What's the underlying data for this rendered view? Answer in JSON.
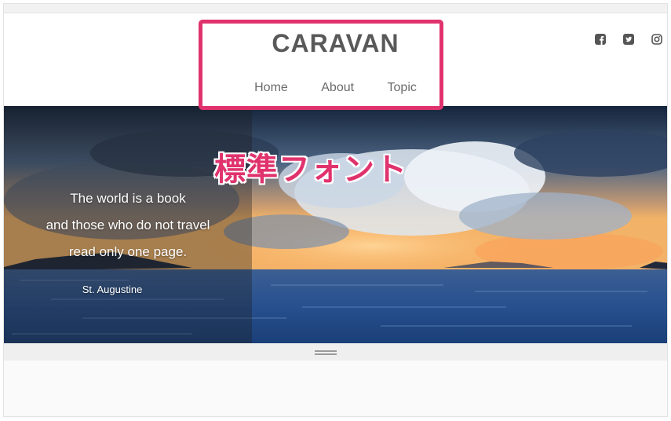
{
  "site": {
    "title": "CARAVAN"
  },
  "nav": {
    "items": [
      "Home",
      "About",
      "Topic"
    ]
  },
  "social": [
    "facebook-icon",
    "twitter-icon",
    "instagram-icon"
  ],
  "hero": {
    "quote_lines": [
      "The world is a book",
      "and those who do not travel",
      "read only one page."
    ],
    "author": "St. Augustine",
    "overlay_label": "標準フォント"
  },
  "colors": {
    "accent": "#e0336d",
    "title": "#595959",
    "nav": "#6a6a6a"
  }
}
